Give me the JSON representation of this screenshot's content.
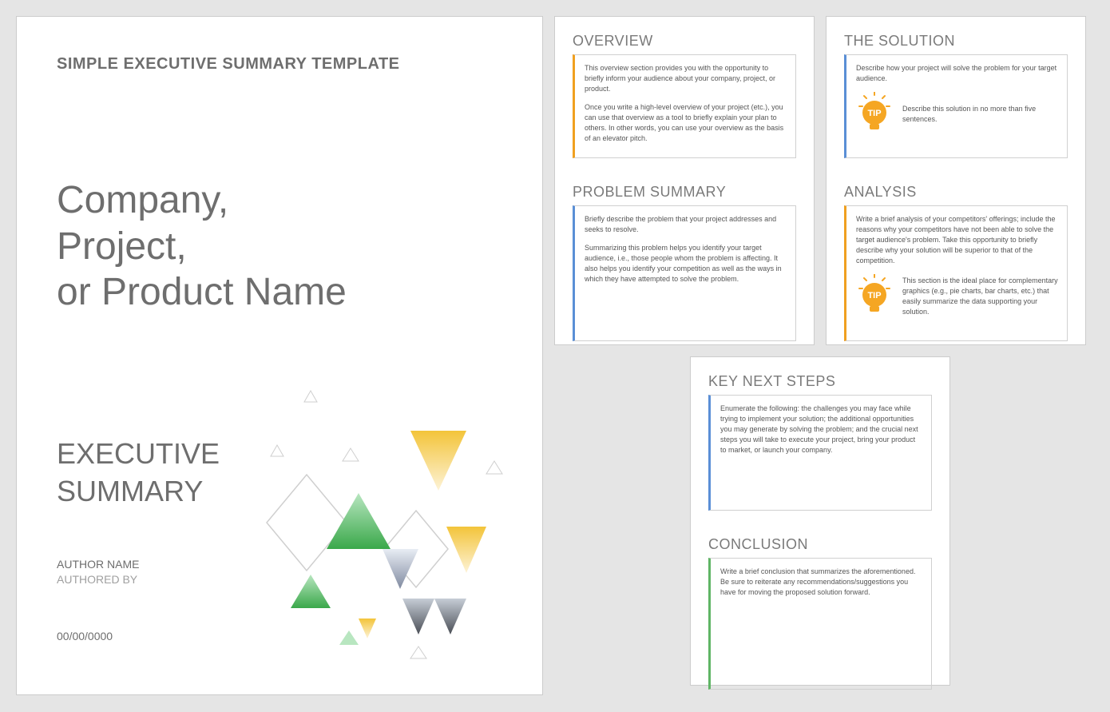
{
  "cover": {
    "header": "SIMPLE EXECUTIVE SUMMARY TEMPLATE",
    "title": "Company,\nProject,\nor Product Name",
    "subtitle": "EXECUTIVE\nSUMMARY",
    "author_name": "AUTHOR NAME",
    "authored_by": "AUTHORED BY",
    "date": "00/00/0000"
  },
  "pages": {
    "overview": {
      "heading": "OVERVIEW",
      "p1": "This overview section provides you with the opportunity to briefly inform your audience about your company, project, or product.",
      "p2": "Once you write a high-level overview of your project (etc.), you can use that overview as a tool to briefly explain your plan to others. In other words, you can use your overview as the basis of an elevator pitch."
    },
    "problem": {
      "heading": "PROBLEM SUMMARY",
      "p1": "Briefly describe the problem that your project addresses and seeks to resolve.",
      "p2": "Summarizing this problem helps you identify your target audience, i.e., those people whom the problem is affecting. It also helps you identify your competition as well as the ways in which they have attempted to solve the problem."
    },
    "solution": {
      "heading": "THE SOLUTION",
      "p1": "Describe how your project will solve the problem for your target audience.",
      "tip": "Describe this solution in no more than five sentences."
    },
    "analysis": {
      "heading": "ANALYSIS",
      "p1": "Write a brief analysis of your competitors' offerings; include the reasons why your competitors have not been able to solve the target audience's problem. Take this opportunity to briefly describe why your solution will be superior to that of the competition.",
      "tip": "This section is the ideal place for complementary graphics (e.g., pie charts, bar charts, etc.) that easily summarize the data supporting your solution."
    },
    "keynext": {
      "heading": "KEY NEXT STEPS",
      "p1": "Enumerate the following: the challenges you may face while trying to implement your solution; the additional opportunities you may generate by solving the problem; and the crucial next steps you will take to execute your project, bring your product to market, or launch your company."
    },
    "conclusion": {
      "heading": "CONCLUSION",
      "p1": "Write a brief conclusion that summarizes the aforementioned. Be sure to reiterate any recommendations/suggestions you have for moving the proposed solution forward."
    }
  },
  "icons": {
    "tip_label": "TIP"
  }
}
